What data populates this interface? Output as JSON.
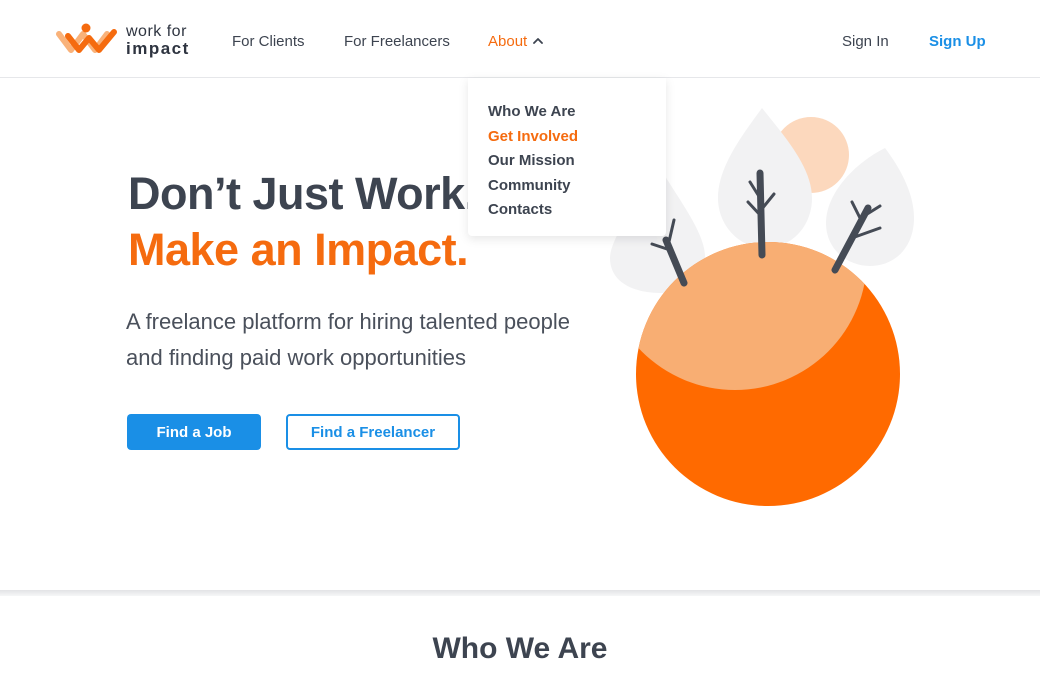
{
  "brand": {
    "logo_line1": "work for",
    "logo_line2": "impact",
    "accent_color": "#f56b0f",
    "link_color": "#1a8fe6"
  },
  "nav": {
    "clients": "For Clients",
    "freelancers": "For Freelancers",
    "about": "About",
    "sign_in": "Sign In",
    "sign_up": "Sign Up"
  },
  "about_menu": {
    "items": [
      "Who We Are",
      "Get Involved",
      "Our Mission",
      "Community",
      "Contacts"
    ],
    "active": "Get Involved"
  },
  "hero": {
    "title_line1": "Don’t Just Work.",
    "title_line2": "Make an Impact.",
    "subtitle": "A freelance platform for hiring talented people and finding paid work opportunities",
    "find_job": "Find a Job",
    "find_freelancer": "Find a Freelancer"
  },
  "section": {
    "title": "Who We Are"
  },
  "icons": {
    "logo": "work-for-impact-logo",
    "about_chevron": "chevron-up-icon",
    "illustration": "planet-trees-illustration"
  }
}
